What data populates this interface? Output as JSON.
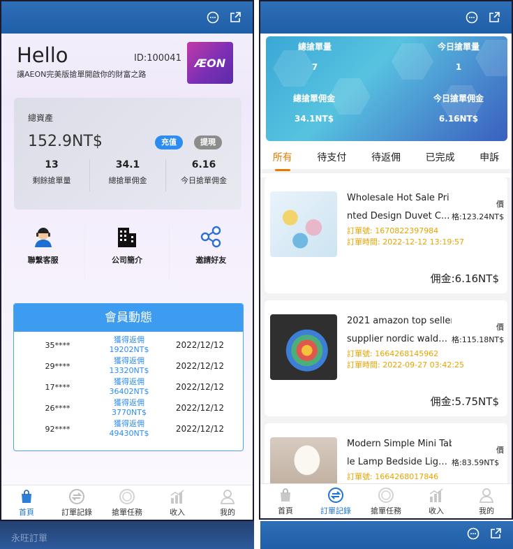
{
  "left": {
    "greeting": "Hello",
    "user_id": "ID:100041",
    "slogan": "讓AEON完美版搶單開啟你的財富之路",
    "logo_text": "ÆON",
    "assets": {
      "label": "總資產",
      "amount": "152.9NT$",
      "deposit_label": "充值",
      "withdraw_label": "提現"
    },
    "stats": [
      {
        "value": "13",
        "label": "剩餘搶單量"
      },
      {
        "value": "34.1",
        "label": "總搶單佣金"
      },
      {
        "value": "6.16",
        "label": "今日搶單佣金"
      }
    ],
    "quick_links": [
      {
        "label": "聯繫客服",
        "icon": "customer-service-icon"
      },
      {
        "label": "公司簡介",
        "icon": "building-icon"
      },
      {
        "label": "邀請好友",
        "icon": "share-icon"
      }
    ],
    "members": {
      "title": "會員動態",
      "rows": [
        {
          "user": "35****",
          "action": "獲得返佣",
          "amount": "19202NT$",
          "date": "2022/12/12"
        },
        {
          "user": "29****",
          "action": "獲得返佣",
          "amount": "13320NT$",
          "date": "2022/12/12"
        },
        {
          "user": "17****",
          "action": "獲得返佣",
          "amount": "36402NT$",
          "date": "2022/12/12"
        },
        {
          "user": "26****",
          "action": "獲得返佣",
          "amount": "3770NT$",
          "date": "2022/12/12"
        },
        {
          "user": "92****",
          "action": "獲得返佣",
          "amount": "49430NT$",
          "date": "2022/12/12"
        }
      ]
    }
  },
  "tabbar": [
    {
      "label": "首頁",
      "icon": "bag-icon"
    },
    {
      "label": "訂單記錄",
      "icon": "exchange-icon"
    },
    {
      "label": "搶單任務",
      "icon": "coin-icon"
    },
    {
      "label": "收入",
      "icon": "chart-icon"
    },
    {
      "label": "我的",
      "icon": "user-icon"
    }
  ],
  "right": {
    "banner": [
      {
        "label": "總搶單量",
        "value": "7"
      },
      {
        "label": "今日搶單量",
        "value": "1"
      },
      {
        "label": "總搶單佣金",
        "value": "34.1NT$"
      },
      {
        "label": "今日搶單佣金",
        "value": "6.16NT$"
      }
    ],
    "filters": [
      "所有",
      "待支付",
      "待返佣",
      "已完成",
      "申訴"
    ],
    "orders": [
      {
        "title1": "Wholesale Hot Sale Pri",
        "title2": "nted Design Duvet C...",
        "price": "格:123.24NT$",
        "price_prefix": "價",
        "order_no": "訂單號: 1670822397984",
        "order_time": "訂單時間: 2022-12-12 13:19:57",
        "commission": "佣金:6.16NT$",
        "colors": [
          "#e8b7c9",
          "#6fb8e2",
          "#f3d36b"
        ]
      },
      {
        "title1": "2021 amazon top seller",
        "title2": "supplier nordic waldo...",
        "price": "格:115.18NT$",
        "price_prefix": "價",
        "order_no": "訂單號: 1664268145962",
        "order_time": "訂單時間: 2022-09-27 03:42:25",
        "commission": "佣金:5.75NT$",
        "colors": [
          "#333333",
          "#e2574c",
          "#f5c23c"
        ]
      },
      {
        "title1": "Modern Simple Mini Tab",
        "title2": "le Lamp Bedside Ligh...",
        "price": "格:83.59NT$",
        "price_prefix": "價",
        "order_no": "訂單號: 1664268017846",
        "order_time": "",
        "commission": "",
        "colors": [
          "#cdbfb3",
          "#f4eee6",
          "#a08c7a"
        ]
      }
    ]
  },
  "bottom_left_title": "永旺訂單"
}
